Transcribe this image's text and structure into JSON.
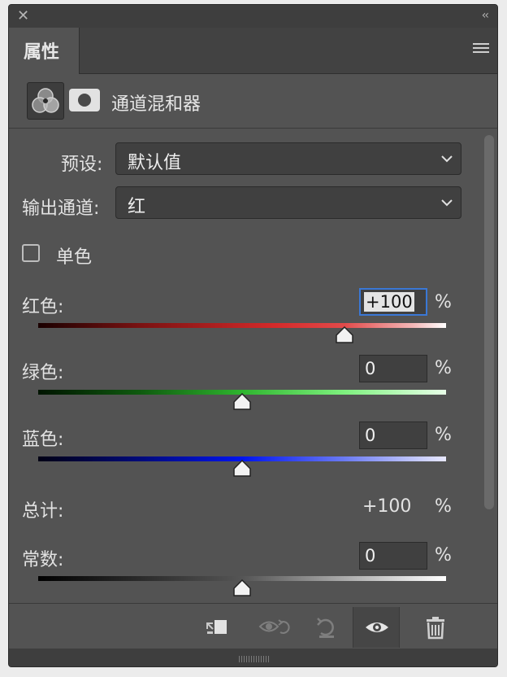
{
  "panel": {
    "tab_label": "属性"
  },
  "header": {
    "title": "通道混和器"
  },
  "preset": {
    "label": "预设:",
    "value": "默认值"
  },
  "output_channel": {
    "label": "输出通道:",
    "value": "红"
  },
  "monochrome": {
    "label": "单色",
    "checked": false
  },
  "sliders": [
    {
      "label": "红色:",
      "value": "+100",
      "unit": "%",
      "position": 1.0,
      "active": true
    },
    {
      "label": "绿色:",
      "value": "0",
      "unit": "%",
      "position": 0.5
    },
    {
      "label": "蓝色:",
      "value": "0",
      "unit": "%",
      "position": 0.5
    }
  ],
  "total": {
    "label": "总计:",
    "value": "+100",
    "unit": "%"
  },
  "constant": {
    "label": "常数:",
    "value": "0",
    "unit": "%",
    "position": 0.5
  },
  "colors": {
    "panel_bg": "#535353",
    "field_bg": "#404040",
    "accent": "#3a78d6"
  },
  "footer_icons": [
    "clip-to-layer-icon",
    "view-previous-state-icon",
    "reset-icon",
    "visibility-eye-icon",
    "trash-icon"
  ]
}
